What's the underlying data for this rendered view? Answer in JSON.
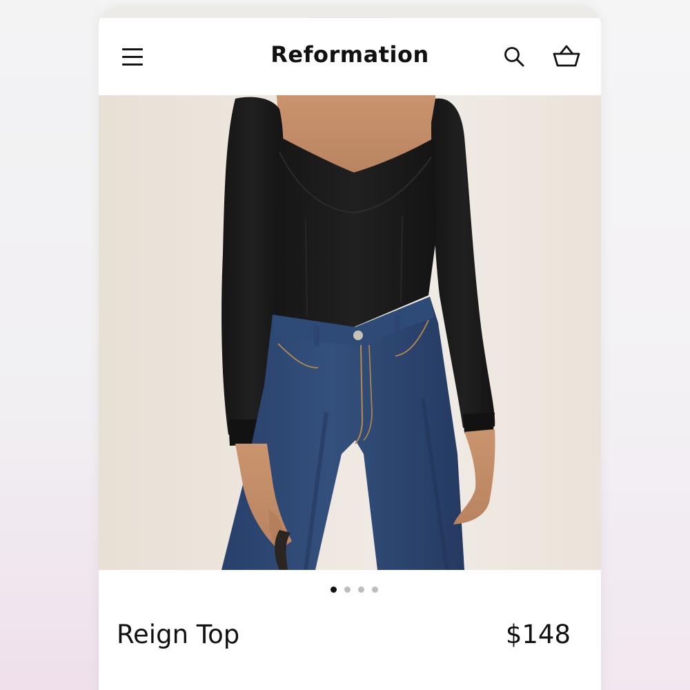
{
  "header": {
    "brand": "Reformation",
    "menu_icon": "hamburger-menu-icon",
    "search_icon": "search-icon",
    "bag_icon": "shopping-basket-icon"
  },
  "product": {
    "name": "Reign Top",
    "price": "$148",
    "image_description": "model wearing black long-sleeve sweetheart-neck top with blue high-waist jeans",
    "gallery": {
      "image_count": 4,
      "active_index": 0
    }
  },
  "colors": {
    "text": "#111111",
    "background": "#ffffff",
    "dot_active": "#111111",
    "dot_inactive": "#bdbdbd",
    "photo_backdrop": "#eee7df"
  }
}
